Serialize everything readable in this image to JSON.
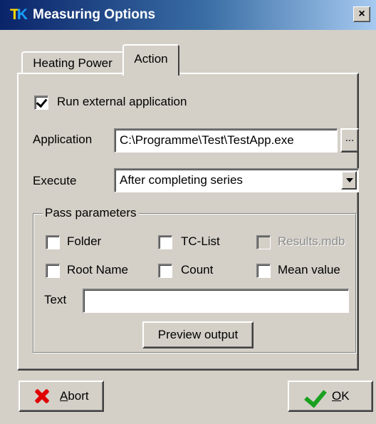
{
  "window": {
    "title": "Measuring Options",
    "icon_letters": [
      "T",
      "K"
    ],
    "close_symbol": "×"
  },
  "tabs": [
    {
      "label": "Heating Power",
      "active": false
    },
    {
      "label": "Action",
      "active": true
    }
  ],
  "action": {
    "run_external": {
      "label": "Run external application",
      "checked": true
    },
    "application": {
      "label": "Application",
      "value": "C:\\Programme\\Test\\TestApp.exe",
      "browse_label": "..."
    },
    "execute": {
      "label": "Execute",
      "value": "After completing series"
    },
    "pass_parameters": {
      "title": "Pass parameters",
      "options": [
        {
          "label": "Folder",
          "checked": false,
          "enabled": true
        },
        {
          "label": "TC-List",
          "checked": false,
          "enabled": true
        },
        {
          "label": "Results.mdb",
          "checked": false,
          "enabled": false
        },
        {
          "label": "Root Name",
          "checked": false,
          "enabled": true
        },
        {
          "label": "Count",
          "checked": false,
          "enabled": true
        },
        {
          "label": "Mean value",
          "checked": false,
          "enabled": true
        }
      ],
      "text_label": "Text",
      "text_value": "",
      "preview_label": "Preview output"
    }
  },
  "buttons": {
    "abort_hotkey": "A",
    "abort_rest": "bort",
    "ok_hotkey": "O",
    "ok_rest": "K"
  },
  "colors": {
    "title_start": "#0a246a",
    "title_end": "#a6caf0",
    "face": "#d4d0c8",
    "abort_icon": "#e00000",
    "ok_icon": "#1aa020"
  }
}
